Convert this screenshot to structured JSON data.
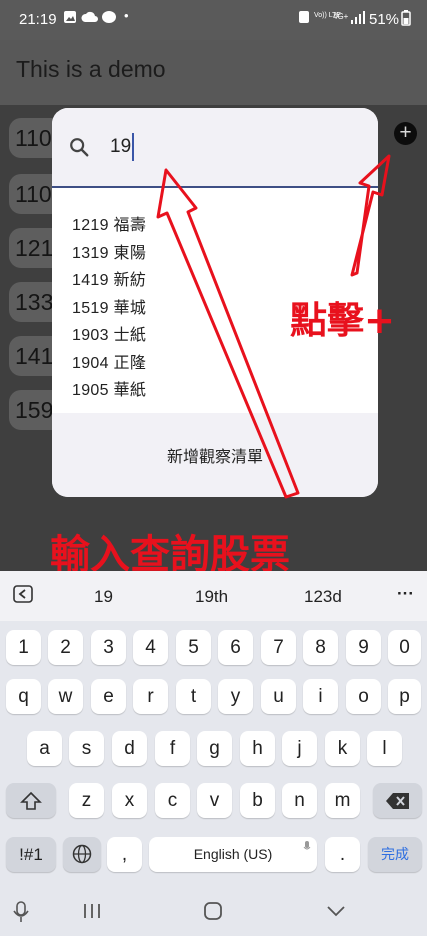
{
  "status_bar": {
    "time": "21:19",
    "battery": "51%",
    "network_volte": "Vo)) LTE",
    "network_4g": "4G+"
  },
  "app_bar": {
    "title": "This is a demo"
  },
  "watchlist_chips": [
    "110",
    "110",
    "121",
    "133",
    "141",
    "159"
  ],
  "add_button": {
    "label": "+"
  },
  "search_dialog": {
    "query": "19",
    "results": [
      "1219 福壽",
      "1319 東陽",
      "1419 新紡",
      "1519 華城",
      "1903 士紙",
      "1904 正隆",
      "1905 華紙"
    ],
    "footer_label": "新增觀察清單"
  },
  "annotations": {
    "tap_plus": "點擊+",
    "type_query": "輸入查詢股票",
    "color": "#e8111d"
  },
  "keyboard": {
    "suggestions": [
      "19",
      "19th",
      "123d"
    ],
    "more": "···",
    "rows": [
      [
        "1",
        "2",
        "3",
        "4",
        "5",
        "6",
        "7",
        "8",
        "9",
        "0"
      ],
      [
        "q",
        "w",
        "e",
        "r",
        "t",
        "y",
        "u",
        "i",
        "o",
        "p"
      ],
      [
        "a",
        "s",
        "d",
        "f",
        "g",
        "h",
        "j",
        "k",
        "l"
      ],
      [
        "z",
        "x",
        "c",
        "v",
        "b",
        "n",
        "m"
      ]
    ],
    "symbols_key": "!#1",
    "comma_key": ",",
    "space_label": "English (US)",
    "period_key": ".",
    "done_label": "完成"
  }
}
